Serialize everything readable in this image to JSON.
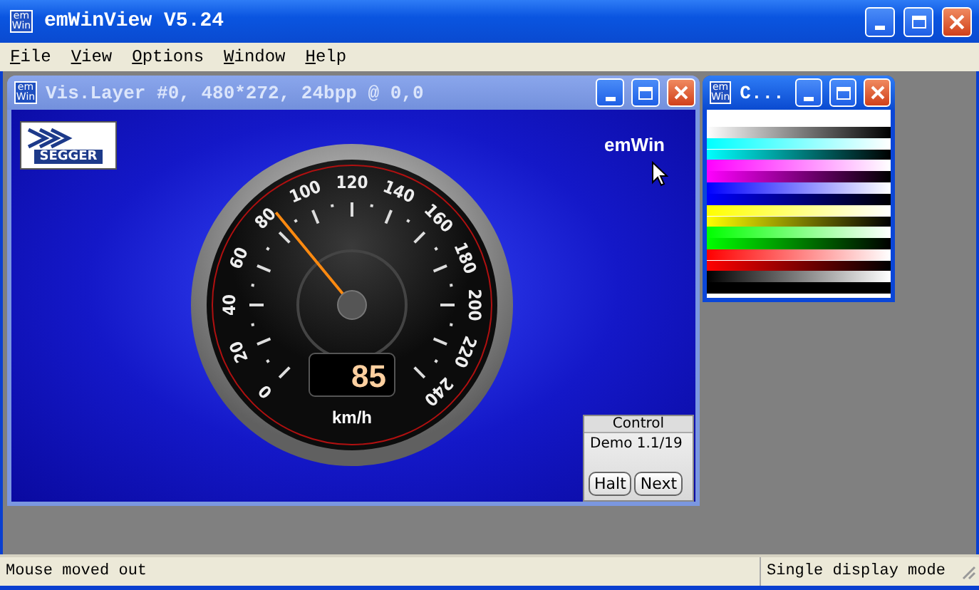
{
  "window": {
    "icon_label": [
      "em",
      "Win"
    ],
    "title": "emWinView V5.24",
    "active": true
  },
  "menu": [
    "File",
    "View",
    "Options",
    "Window",
    "Help"
  ],
  "child_windows": [
    {
      "kind": "display",
      "icon_label": [
        "em",
        "Win"
      ],
      "title": "Vis.Layer #0, 480*272, 24bpp @ 0,0",
      "active": false
    },
    {
      "kind": "colors",
      "icon_label": [
        "em",
        "Win"
      ],
      "title": "C...",
      "active": true
    }
  ],
  "display": {
    "logo": "SEGGER",
    "brand": "emWin",
    "gauge": {
      "scale_labels": [
        "0",
        "20",
        "40",
        "60",
        "80",
        "100",
        "120",
        "140",
        "160",
        "180",
        "200",
        "220",
        "240"
      ],
      "level": 0.354,
      "value": "85",
      "unit": "km/h"
    },
    "control": {
      "title": "Control",
      "text": "Demo 1.1/19",
      "buttons": [
        "Halt",
        "Next"
      ]
    }
  },
  "color_strips": [
    {
      "color": "#ffffff"
    },
    {
      "color": "#00ffff"
    },
    {
      "color": "#ff00ff"
    },
    {
      "color": "#0000ff"
    },
    {
      "color": "#ffff00"
    },
    {
      "color": "#00ff00"
    },
    {
      "color": "#ff0000"
    },
    {
      "color": "#000000"
    }
  ],
  "status_bar": [
    "Mouse moved out",
    "Single display mode"
  ]
}
